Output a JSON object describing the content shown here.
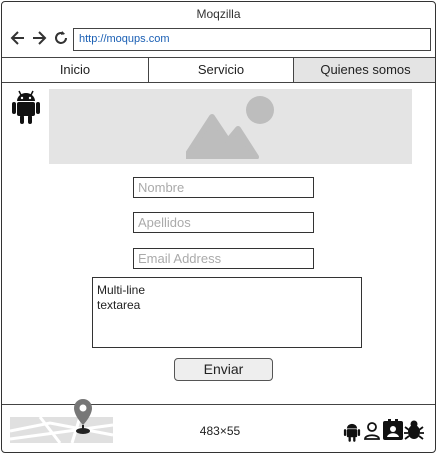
{
  "window": {
    "title": "Moqzilla"
  },
  "browser": {
    "url": "http://moqups.com"
  },
  "tabs": [
    {
      "label": "Inicio"
    },
    {
      "label": "Servicio"
    },
    {
      "label": "Quienes somos"
    }
  ],
  "form": {
    "nombre_placeholder": "Nombre",
    "apellidos_placeholder": "Apellidos",
    "email_placeholder": "Email Address",
    "textarea_text": "Multi-line\ntextarea",
    "submit_label": "Enviar"
  },
  "footer": {
    "dimensions": "483×55"
  },
  "icons": {
    "back": "arrow-left-icon",
    "forward": "arrow-right-icon",
    "reload": "reload-icon",
    "logo": "android-icon",
    "hero": "image-placeholder-icon",
    "map": "map-pin-icon",
    "footer": [
      "android-icon",
      "user-icon",
      "contact-card-icon",
      "bug-icon"
    ]
  },
  "colors": {
    "accent_link": "#1a5fb4",
    "placeholder_bg": "#e4e4e4"
  }
}
